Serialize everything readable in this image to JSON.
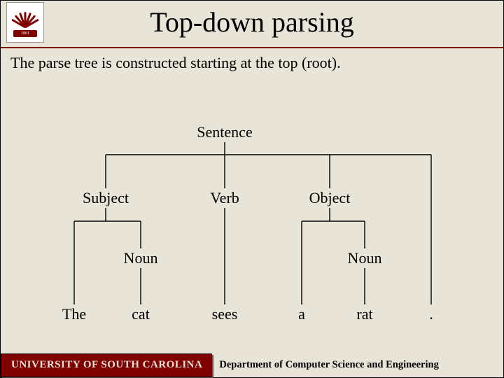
{
  "title": "Top-down parsing",
  "subtitle": "The parse tree is constructed starting at the top  (root).",
  "logo_year": "1801",
  "tree": {
    "root": "Sentence",
    "mid": {
      "subject": "Subject",
      "verb": "Verb",
      "object": "Object"
    },
    "inner": {
      "noun1": "Noun",
      "noun2": "Noun"
    },
    "leaves": {
      "the": "The",
      "cat": "cat",
      "sees": "sees",
      "a": "a",
      "rat": "rat",
      "dot": "."
    }
  },
  "footer": {
    "left": "UNIVERSITY OF SOUTH CAROLINA",
    "right": "Department of Computer Science and Engineering"
  }
}
